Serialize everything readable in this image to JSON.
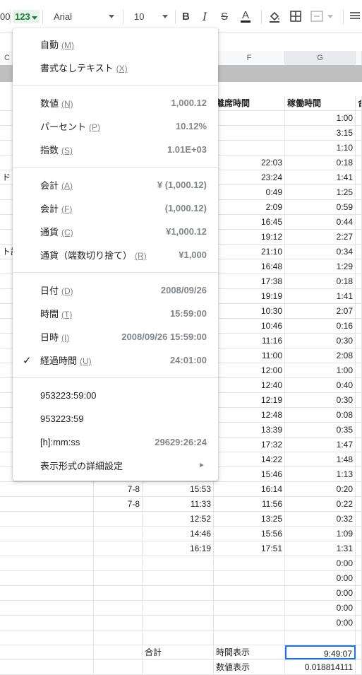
{
  "toolbar": {
    "zoom_partial": "00",
    "format_button": "123",
    "font": "Arial",
    "font_size": "10"
  },
  "sheet": {
    "columns": [
      "C",
      "F",
      "G"
    ],
    "header_row": {
      "f": "離席時間",
      "g": "稼働時間",
      "h": "合"
    },
    "c_partial": [
      "ド",
      "ト記"
    ],
    "rows": [
      {
        "e": "",
        "f": "",
        "g": "1:00"
      },
      {
        "e": "",
        "f": "",
        "g": "3:15"
      },
      {
        "e": "",
        "f": "",
        "g": "1:10"
      },
      {
        "e": "",
        "f": "22:03",
        "g": "0:18"
      },
      {
        "e": "",
        "f": "23:24",
        "g": "1:41"
      },
      {
        "e": "",
        "f": "0:49",
        "g": "1:25"
      },
      {
        "e": "",
        "f": "2:09",
        "g": "0:59"
      },
      {
        "e": "",
        "f": "16:45",
        "g": "0:44"
      },
      {
        "e": "",
        "f": "19:12",
        "g": "2:27"
      },
      {
        "e": "",
        "f": "21:10",
        "g": "0:34"
      },
      {
        "e": "",
        "f": "16:48",
        "g": "1:29"
      },
      {
        "e": "",
        "f": "17:38",
        "g": "0:18"
      },
      {
        "e": "",
        "f": "19:19",
        "g": "1:41"
      },
      {
        "e": "",
        "f": "10:30",
        "g": "2:07"
      },
      {
        "e": "",
        "f": "10:46",
        "g": "0:16"
      },
      {
        "e": "",
        "f": "11:16",
        "g": "0:30"
      },
      {
        "e": "",
        "f": "11:00",
        "g": "2:08"
      },
      {
        "e": "",
        "f": "12:00",
        "g": "1:00"
      },
      {
        "e": "",
        "f": "12:40",
        "g": "0:40"
      },
      {
        "e": "",
        "f": "12:19",
        "g": "0:30"
      },
      {
        "e": "",
        "f": "12:48",
        "g": "0:08"
      },
      {
        "e": "",
        "f": "13:39",
        "g": "0:35"
      },
      {
        "e": "",
        "f": "17:32",
        "g": "1:47"
      },
      {
        "e": "",
        "f": "14:22",
        "g": "1:48"
      },
      {
        "e": "",
        "f": "15:46",
        "g": "1:13"
      },
      {
        "d": "7-8",
        "e": "15:53",
        "f": "16:14",
        "g": "0:20"
      },
      {
        "d": "7-8",
        "e": "11:33",
        "f": "11:56",
        "g": "0:22"
      },
      {
        "d": "",
        "e": "12:52",
        "f": "13:25",
        "g": "0:32"
      },
      {
        "d": "",
        "e": "14:46",
        "f": "15:56",
        "g": "1:09"
      },
      {
        "d": "",
        "e": "16:19",
        "f": "17:51",
        "g": "1:31"
      },
      {
        "d": "",
        "e": "",
        "f": "",
        "g": "0:00"
      },
      {
        "d": "",
        "e": "",
        "f": "",
        "g": "0:00"
      },
      {
        "d": "",
        "e": "",
        "f": "",
        "g": "0:00"
      },
      {
        "d": "",
        "e": "",
        "f": "",
        "g": "0:00"
      },
      {
        "d": "",
        "e": "",
        "f": "",
        "g": "0:00"
      }
    ],
    "total_row": {
      "e": "合計",
      "f": "時間表示",
      "g": "9:49:07"
    },
    "partial_row": {
      "f": "数値表示",
      "g": "0.018814111"
    }
  },
  "menu": {
    "items": [
      {
        "label": "自動",
        "key": "(M)",
        "value": ""
      },
      {
        "label": "書式なしテキスト",
        "key": "(X)",
        "value": ""
      },
      {
        "label": "数値",
        "key": "(N)",
        "value": "1,000.12"
      },
      {
        "label": "パーセント",
        "key": "(P)",
        "value": "10.12%"
      },
      {
        "label": "指数",
        "key": "(S)",
        "value": "1.01E+03"
      },
      {
        "label": "会計",
        "key": "(A)",
        "value": "¥ (1,000.12)"
      },
      {
        "label": "会計",
        "key": "(F)",
        "value": "(1,000.12)"
      },
      {
        "label": "通貨",
        "key": "(C)",
        "value": "¥1,000.12"
      },
      {
        "label": "通貨（端数切り捨て）",
        "key": "(R)",
        "value": "¥1,000"
      },
      {
        "label": "日付",
        "key": "(D)",
        "value": "2008/09/26"
      },
      {
        "label": "時間",
        "key": "(T)",
        "value": "15:59:00"
      },
      {
        "label": "日時",
        "key": "(I)",
        "value": "2008/09/26 15:59:00"
      },
      {
        "label": "経過時間",
        "key": "(U)",
        "value": "24:01:00",
        "checked": true
      },
      {
        "label": "953223:59:00",
        "key": "",
        "value": ""
      },
      {
        "label": "953223:59",
        "key": "",
        "value": ""
      },
      {
        "label": "[h]:mm:ss",
        "key": "",
        "value": "29629:26:24"
      },
      {
        "label": "表示形式の詳細設定",
        "key": "",
        "value": "",
        "submenu": true
      }
    ],
    "check_glyph": "✓",
    "submenu_glyph": "►"
  }
}
